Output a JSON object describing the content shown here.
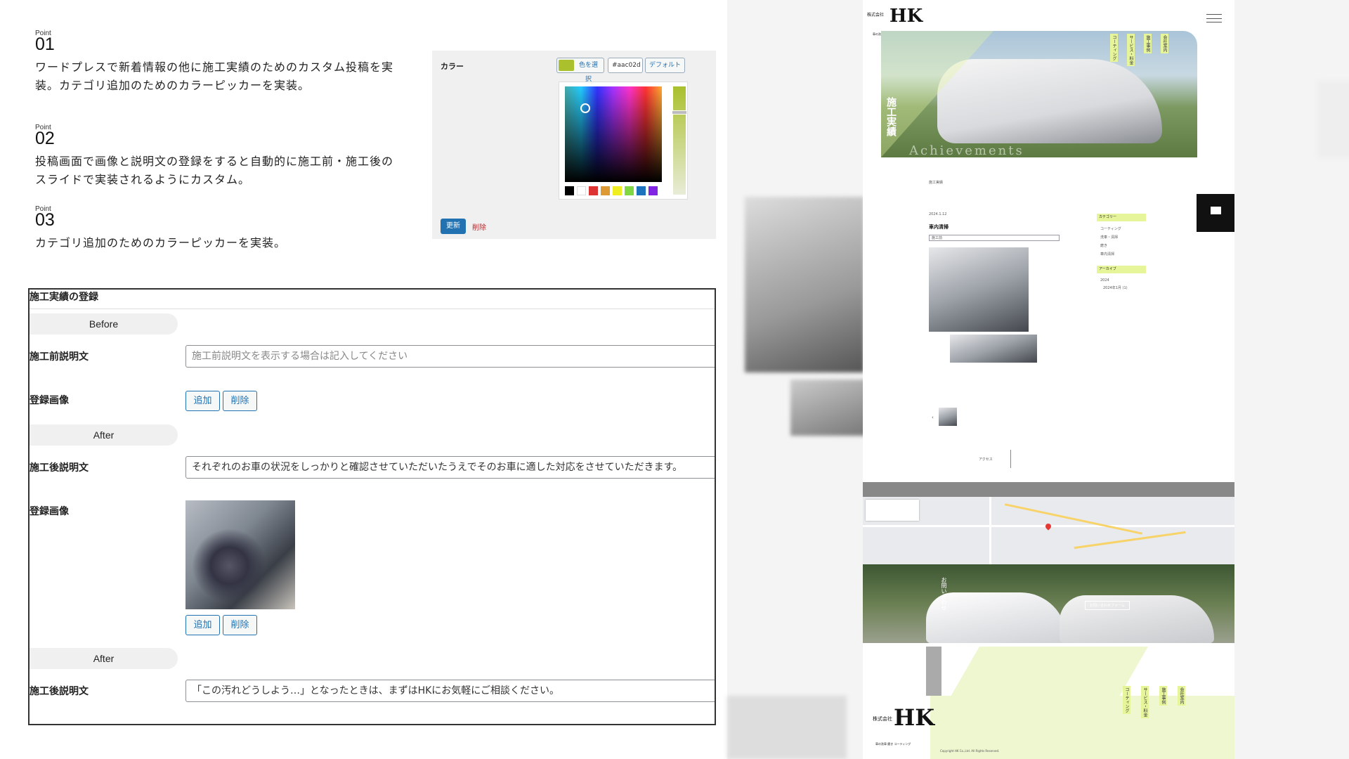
{
  "points": [
    {
      "label": "Point",
      "number": "01",
      "text": "ワードプレスで新着情報の他に施工実績のためのカスタム投稿を実装。カテゴリ追加のためのカラーピッカーを実装。"
    },
    {
      "label": "Point",
      "number": "02",
      "text": "投稿画面で画像と説明文の登録をすると自動的に施工前・施工後のスライドで実装されるようにカスタム。"
    },
    {
      "label": "Point",
      "number": "03",
      "text": "カテゴリ追加のためのカラーピッカーを実装。"
    }
  ],
  "color_picker": {
    "title": "カラー",
    "select_label": "色を選択",
    "hex_value": "#aac02d",
    "default_label": "デフォルト",
    "update_label": "更新",
    "delete_label": "削除",
    "current_color": "#aac02d",
    "palette": [
      "#000000",
      "#ffffff",
      "#dd3333",
      "#dd9933",
      "#eeee22",
      "#81d742",
      "#1e73be",
      "#8224e3"
    ]
  },
  "form": {
    "heading": "施工実績の登録",
    "sections": [
      {
        "pill": "Before",
        "desc_label": "施工前説明文",
        "desc_value": "",
        "desc_placeholder": "施工前説明文を表示する場合は記入してください",
        "image_label": "登録画像",
        "add_label": "追加",
        "delete_label": "削除"
      },
      {
        "pill": "After",
        "desc_label": "施工後説明文",
        "desc_value": "それぞれのお車の状況をしっかりと確認させていただいたうえでそのお車に適した対応をさせていただきます。",
        "image_label": "登録画像",
        "add_label": "追加",
        "delete_label": "削除"
      },
      {
        "pill": "After",
        "desc_label": "施工後説明文",
        "desc_value": "「この汚れどうしよう…」となったときは、まずはHKにお気軽にご相談ください。"
      }
    ]
  },
  "site": {
    "logo_company": "株式会社",
    "logo_mark": "HK",
    "logo_sub": "車の洗車 磨き コーティング",
    "hero_vertical": "施工実績",
    "hero_english": "Achievements",
    "nav_tags": [
      "会社案内",
      "施工事例",
      "サービス・料金",
      "コーティング"
    ],
    "breadcrumb": "施工実績",
    "post_date": "2024.1.12",
    "post_title": "車内清掃",
    "post_tag": "施工前",
    "category_label": "カテゴリー",
    "archive_label": "アーカイブ",
    "category_items": [
      "コーティング",
      "洗車・清掃",
      "磨き",
      "車内清掃"
    ],
    "archive_items": [
      "2024",
      "2024年1月 (1)"
    ],
    "access_label": "アクセス",
    "contact_vertical": "お問い合わせ",
    "contact_form_label": "お問い合わせフォーム",
    "copyright": "Copyright HK Co.,Ltd. All Rights Reserved."
  }
}
